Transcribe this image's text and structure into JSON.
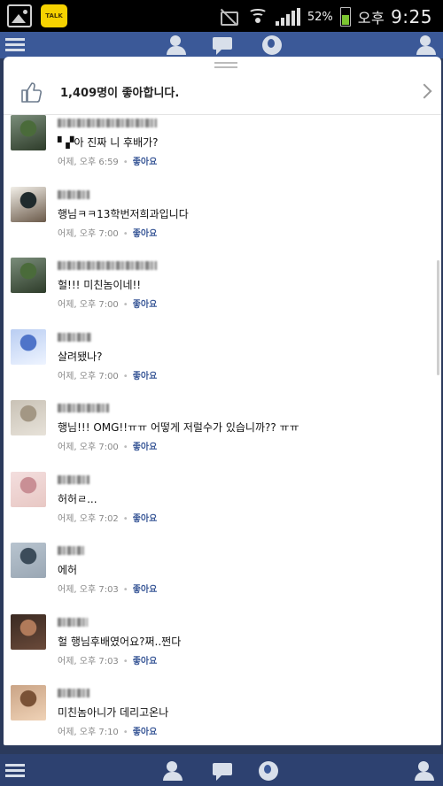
{
  "status_bar": {
    "battery_percent": "52%",
    "ampm": "오후",
    "time": "9:25",
    "talk_label": "TALK",
    "icons": [
      "gallery-icon",
      "kakaotalk-icon",
      "mute-icon",
      "wifi-icon",
      "signal-icon",
      "battery-icon"
    ]
  },
  "likes": {
    "text": "1,409명이 좋아합니다."
  },
  "comments": [
    {
      "text": "▘▞아 진짜 니 후배가?",
      "time": "어제, 오후 6:59",
      "like": "좋아요",
      "avatar_colors": [
        "#7a8d7a",
        "#4a6b3a",
        "#2e3c2a"
      ]
    },
    {
      "text": "행님ㅋㅋ13학번저희과입니다",
      "time": "어제, 오후 7:00",
      "like": "좋아요",
      "avatar_colors": [
        "#f2efe8",
        "#1f2a2c",
        "#6b5a4a"
      ]
    },
    {
      "text": "헐!!! 미친놈이네!!",
      "time": "어제, 오후 7:00",
      "like": "좋아요",
      "avatar_colors": [
        "#7a8d7a",
        "#4a6b3a",
        "#2e3c2a"
      ]
    },
    {
      "text": "살려됐나?",
      "time": "어제, 오후 7:00",
      "like": "좋아요",
      "avatar_colors": [
        "#b9cdf2",
        "#4f74c9",
        "#eef4ff"
      ]
    },
    {
      "text": "행님!!! OMG!!ㅠㅠ 어떻게 저럴수가 있습니까?? ㅠㅠ",
      "time": "어제, 오후 7:00",
      "like": "좋아요",
      "avatar_colors": [
        "#c9c2b6",
        "#a39784",
        "#e7e2d9"
      ]
    },
    {
      "text": "허허ㄹ...",
      "time": "어제, 오후 7:02",
      "like": "좋아요",
      "avatar_colors": [
        "#f3dede",
        "#c98f95",
        "#e8c8c4"
      ]
    },
    {
      "text": "에허",
      "time": "어제, 오후 7:03",
      "like": "좋아요",
      "avatar_colors": [
        "#b8c4cf",
        "#3c4c5a",
        "#9aa7b4"
      ]
    },
    {
      "text": "헐 행님후배였어요?쩌..쩐다",
      "time": "어제, 오후 7:03",
      "like": "좋아요",
      "avatar_colors": [
        "#3a2a22",
        "#b07a5a",
        "#6a4a3a"
      ]
    },
    {
      "text": "미친놈아니가 데리고온나",
      "time": "어제, 오후 7:10",
      "like": "좋아요",
      "avatar_colors": [
        "#caa486",
        "#7a5236",
        "#efd2b6"
      ]
    }
  ],
  "app_bar": {
    "icons": [
      "menu-icon",
      "friends-icon",
      "messages-icon",
      "notifications-globe-icon",
      "friend-requests-icon"
    ]
  },
  "colors": {
    "brand": "#3b5998",
    "link": "#3b5998",
    "meta_text": "#888888"
  }
}
